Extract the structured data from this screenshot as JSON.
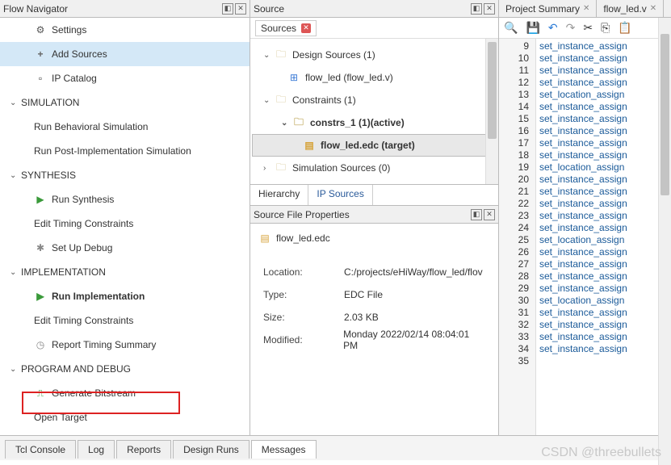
{
  "nav": {
    "title": "Flow Navigator",
    "settings": "Settings",
    "addSources": "Add Sources",
    "ipCatalog": "IP Catalog",
    "simulation": "SIMULATION",
    "runBehav": "Run Behavioral Simulation",
    "runPost": "Run Post-Implementation Simulation",
    "synthesis": "SYNTHESIS",
    "runSynth": "Run Synthesis",
    "editTiming1": "Edit Timing Constraints",
    "setupDebug": "Set Up Debug",
    "impl": "IMPLEMENTATION",
    "runImpl": "Run Implementation",
    "editTiming2": "Edit Timing Constraints",
    "reportTiming": "Report Timing Summary",
    "progDebug": "PROGRAM AND DEBUG",
    "genBit": "Generate Bitstream",
    "openTarget": "Open Target"
  },
  "src": {
    "title": "Source",
    "tab": "Sources",
    "designSources": "Design Sources (1)",
    "flowLed": "flow_led (flow_led.v)",
    "constraints": "Constraints (1)",
    "constrs1": "constrs_1 (1)(active)",
    "edc": "flow_led.edc (target)",
    "simSources": "Simulation Sources (0)",
    "tabHier": "Hierarchy",
    "tabIp": "IP Sources"
  },
  "props": {
    "title": "Source File Properties",
    "file": "flow_led.edc",
    "locLbl": "Location:",
    "locVal": "C:/projects/eHiWay/flow_led/flov",
    "typeLbl": "Type:",
    "typeVal": "EDC File",
    "sizeLbl": "Size:",
    "sizeVal": "2.03 KB",
    "modLbl": "Modified:",
    "modVal": "Monday 2022/02/14 08:04:01 PM"
  },
  "ed": {
    "tab1": "Project Summary",
    "tab2": "flow_led.v",
    "lines": [
      {
        "n": "9",
        "t": "set_instance_assign"
      },
      {
        "n": "10",
        "t": "set_instance_assign"
      },
      {
        "n": "11",
        "t": "set_instance_assign"
      },
      {
        "n": "12",
        "t": "set_instance_assign"
      },
      {
        "n": "13",
        "t": "set_location_assign"
      },
      {
        "n": "14",
        "t": "set_instance_assign"
      },
      {
        "n": "15",
        "t": "set_instance_assign"
      },
      {
        "n": "16",
        "t": "set_instance_assign"
      },
      {
        "n": "17",
        "t": "set_instance_assign"
      },
      {
        "n": "18",
        "t": "set_instance_assign"
      },
      {
        "n": "19",
        "t": "set_location_assign"
      },
      {
        "n": "20",
        "t": "set_instance_assign"
      },
      {
        "n": "21",
        "t": "set_instance_assign"
      },
      {
        "n": "22",
        "t": "set_instance_assign"
      },
      {
        "n": "23",
        "t": "set_instance_assign"
      },
      {
        "n": "24",
        "t": "set_instance_assign"
      },
      {
        "n": "25",
        "t": "set_location_assign"
      },
      {
        "n": "26",
        "t": "set_instance_assign"
      },
      {
        "n": "27",
        "t": "set_instance_assign"
      },
      {
        "n": "28",
        "t": "set_instance_assign"
      },
      {
        "n": "29",
        "t": "set_instance_assign"
      },
      {
        "n": "30",
        "t": "set_location_assign"
      },
      {
        "n": "31",
        "t": "set_instance_assign"
      },
      {
        "n": "32",
        "t": "set_instance_assign"
      },
      {
        "n": "33",
        "t": "set_instance_assign"
      },
      {
        "n": "34",
        "t": "set_instance_assign"
      },
      {
        "n": "35",
        "t": ""
      }
    ]
  },
  "bottom": {
    "tcl": "Tcl Console",
    "log": "Log",
    "reports": "Reports",
    "design": "Design Runs",
    "msg": "Messages"
  },
  "wm": "CSDN @threebullets"
}
